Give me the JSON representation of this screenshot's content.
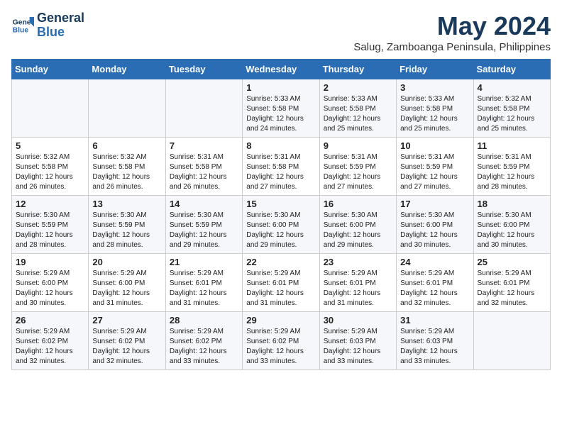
{
  "header": {
    "logo_line1": "General",
    "logo_line2": "Blue",
    "month": "May 2024",
    "location": "Salug, Zamboanga Peninsula, Philippines"
  },
  "weekdays": [
    "Sunday",
    "Monday",
    "Tuesday",
    "Wednesday",
    "Thursday",
    "Friday",
    "Saturday"
  ],
  "weeks": [
    [
      {
        "day": "",
        "info": ""
      },
      {
        "day": "",
        "info": ""
      },
      {
        "day": "",
        "info": ""
      },
      {
        "day": "1",
        "info": "Sunrise: 5:33 AM\nSunset: 5:58 PM\nDaylight: 12 hours\nand 24 minutes."
      },
      {
        "day": "2",
        "info": "Sunrise: 5:33 AM\nSunset: 5:58 PM\nDaylight: 12 hours\nand 25 minutes."
      },
      {
        "day": "3",
        "info": "Sunrise: 5:33 AM\nSunset: 5:58 PM\nDaylight: 12 hours\nand 25 minutes."
      },
      {
        "day": "4",
        "info": "Sunrise: 5:32 AM\nSunset: 5:58 PM\nDaylight: 12 hours\nand 25 minutes."
      }
    ],
    [
      {
        "day": "5",
        "info": "Sunrise: 5:32 AM\nSunset: 5:58 PM\nDaylight: 12 hours\nand 26 minutes."
      },
      {
        "day": "6",
        "info": "Sunrise: 5:32 AM\nSunset: 5:58 PM\nDaylight: 12 hours\nand 26 minutes."
      },
      {
        "day": "7",
        "info": "Sunrise: 5:31 AM\nSunset: 5:58 PM\nDaylight: 12 hours\nand 26 minutes."
      },
      {
        "day": "8",
        "info": "Sunrise: 5:31 AM\nSunset: 5:58 PM\nDaylight: 12 hours\nand 27 minutes."
      },
      {
        "day": "9",
        "info": "Sunrise: 5:31 AM\nSunset: 5:59 PM\nDaylight: 12 hours\nand 27 minutes."
      },
      {
        "day": "10",
        "info": "Sunrise: 5:31 AM\nSunset: 5:59 PM\nDaylight: 12 hours\nand 27 minutes."
      },
      {
        "day": "11",
        "info": "Sunrise: 5:31 AM\nSunset: 5:59 PM\nDaylight: 12 hours\nand 28 minutes."
      }
    ],
    [
      {
        "day": "12",
        "info": "Sunrise: 5:30 AM\nSunset: 5:59 PM\nDaylight: 12 hours\nand 28 minutes."
      },
      {
        "day": "13",
        "info": "Sunrise: 5:30 AM\nSunset: 5:59 PM\nDaylight: 12 hours\nand 28 minutes."
      },
      {
        "day": "14",
        "info": "Sunrise: 5:30 AM\nSunset: 5:59 PM\nDaylight: 12 hours\nand 29 minutes."
      },
      {
        "day": "15",
        "info": "Sunrise: 5:30 AM\nSunset: 6:00 PM\nDaylight: 12 hours\nand 29 minutes."
      },
      {
        "day": "16",
        "info": "Sunrise: 5:30 AM\nSunset: 6:00 PM\nDaylight: 12 hours\nand 29 minutes."
      },
      {
        "day": "17",
        "info": "Sunrise: 5:30 AM\nSunset: 6:00 PM\nDaylight: 12 hours\nand 30 minutes."
      },
      {
        "day": "18",
        "info": "Sunrise: 5:30 AM\nSunset: 6:00 PM\nDaylight: 12 hours\nand 30 minutes."
      }
    ],
    [
      {
        "day": "19",
        "info": "Sunrise: 5:29 AM\nSunset: 6:00 PM\nDaylight: 12 hours\nand 30 minutes."
      },
      {
        "day": "20",
        "info": "Sunrise: 5:29 AM\nSunset: 6:00 PM\nDaylight: 12 hours\nand 31 minutes."
      },
      {
        "day": "21",
        "info": "Sunrise: 5:29 AM\nSunset: 6:01 PM\nDaylight: 12 hours\nand 31 minutes."
      },
      {
        "day": "22",
        "info": "Sunrise: 5:29 AM\nSunset: 6:01 PM\nDaylight: 12 hours\nand 31 minutes."
      },
      {
        "day": "23",
        "info": "Sunrise: 5:29 AM\nSunset: 6:01 PM\nDaylight: 12 hours\nand 31 minutes."
      },
      {
        "day": "24",
        "info": "Sunrise: 5:29 AM\nSunset: 6:01 PM\nDaylight: 12 hours\nand 32 minutes."
      },
      {
        "day": "25",
        "info": "Sunrise: 5:29 AM\nSunset: 6:01 PM\nDaylight: 12 hours\nand 32 minutes."
      }
    ],
    [
      {
        "day": "26",
        "info": "Sunrise: 5:29 AM\nSunset: 6:02 PM\nDaylight: 12 hours\nand 32 minutes."
      },
      {
        "day": "27",
        "info": "Sunrise: 5:29 AM\nSunset: 6:02 PM\nDaylight: 12 hours\nand 32 minutes."
      },
      {
        "day": "28",
        "info": "Sunrise: 5:29 AM\nSunset: 6:02 PM\nDaylight: 12 hours\nand 33 minutes."
      },
      {
        "day": "29",
        "info": "Sunrise: 5:29 AM\nSunset: 6:02 PM\nDaylight: 12 hours\nand 33 minutes."
      },
      {
        "day": "30",
        "info": "Sunrise: 5:29 AM\nSunset: 6:03 PM\nDaylight: 12 hours\nand 33 minutes."
      },
      {
        "day": "31",
        "info": "Sunrise: 5:29 AM\nSunset: 6:03 PM\nDaylight: 12 hours\nand 33 minutes."
      },
      {
        "day": "",
        "info": ""
      }
    ]
  ]
}
